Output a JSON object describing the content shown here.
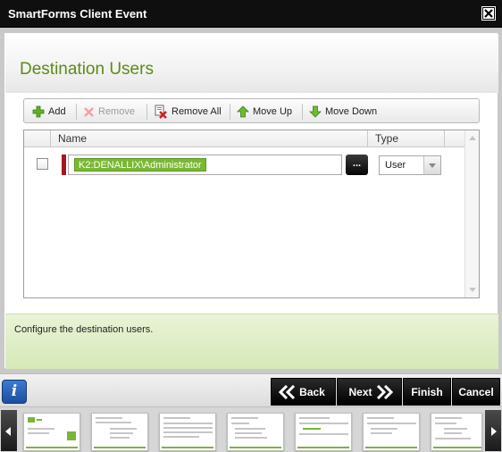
{
  "window": {
    "title": "SmartForms Client Event",
    "close_icon": "close-icon"
  },
  "page": {
    "title": "Destination Users"
  },
  "toolbar": {
    "add": "Add",
    "remove": "Remove",
    "remove_all": "Remove All",
    "move_up": "Move Up",
    "move_down": "Move Down"
  },
  "grid": {
    "columns": [
      "Name",
      "Type"
    ],
    "rows": [
      {
        "name": "K2:DENALLIX\\Administrator",
        "browse_label": "...",
        "type": "User"
      }
    ]
  },
  "hint": {
    "text": "Configure the destination users."
  },
  "footer": {
    "info_label": "i",
    "back": "Back",
    "next": "Next",
    "finish": "Finish",
    "cancel": "Cancel"
  },
  "thumbnails": {
    "count": 7
  },
  "colors": {
    "title_bar": "#0f0f0f",
    "page_title": "#5d8a16",
    "token": "#78b833",
    "row_marker": "#a31820",
    "info_button": "#2b65b8"
  }
}
